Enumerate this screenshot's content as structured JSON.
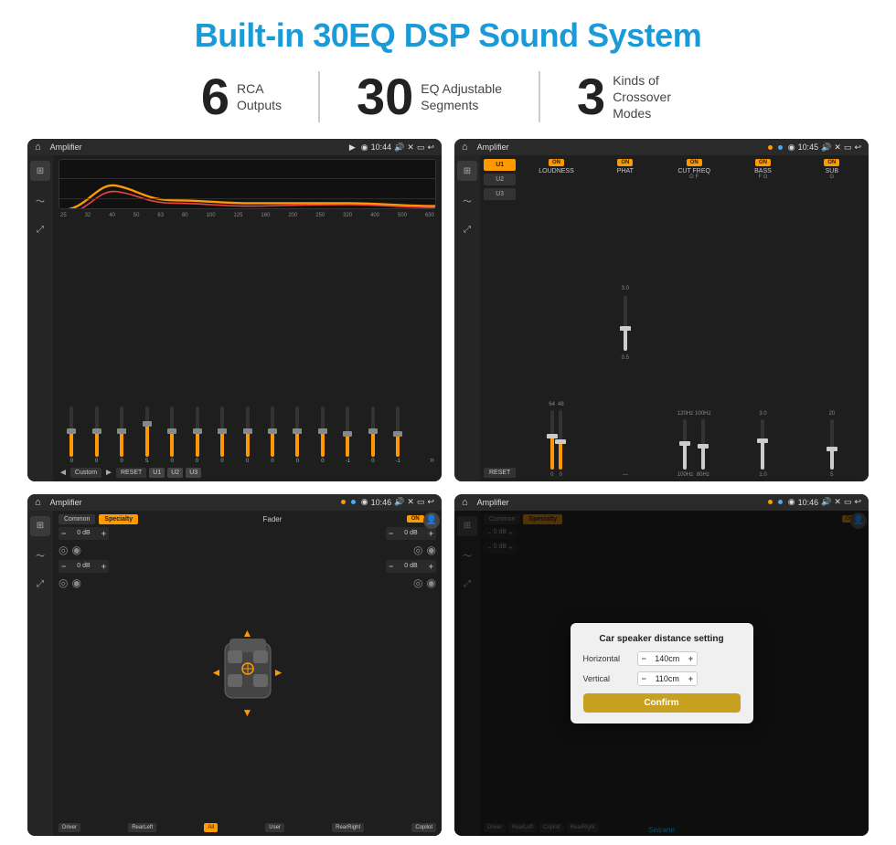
{
  "header": {
    "title": "Built-in 30EQ DSP Sound System",
    "title_color": "#1a9ad7"
  },
  "stats": [
    {
      "number": "6",
      "label": "RCA\nOutputs"
    },
    {
      "number": "30",
      "label": "EQ Adjustable\nSegments"
    },
    {
      "number": "3",
      "label": "Kinds of\nCrossover Modes"
    }
  ],
  "screens": {
    "top_left": {
      "status_bar": {
        "title": "Amplifier",
        "time": "10:44"
      },
      "eq_freqs": [
        "25",
        "32",
        "40",
        "50",
        "63",
        "80",
        "100",
        "125",
        "160",
        "200",
        "250",
        "320",
        "400",
        "500",
        "630"
      ],
      "eq_values": [
        "0",
        "0",
        "0",
        "5",
        "0",
        "0",
        "0",
        "0",
        "0",
        "0",
        "0",
        "-1",
        "0",
        "-1"
      ],
      "bottom_buttons": [
        "Custom",
        "RESET",
        "U1",
        "U2",
        "U3"
      ]
    },
    "top_right": {
      "status_bar": {
        "title": "Amplifier",
        "time": "10:45"
      },
      "presets": [
        "U1",
        "U2",
        "U3"
      ],
      "controls": [
        {
          "on": true,
          "label": "LOUDNESS"
        },
        {
          "on": true,
          "label": "PHAT"
        },
        {
          "on": true,
          "label": "CUT FREQ"
        },
        {
          "on": true,
          "label": "BASS"
        },
        {
          "on": true,
          "label": "SUB"
        }
      ],
      "reset_btn": "RESET"
    },
    "bottom_left": {
      "status_bar": {
        "title": "Amplifier",
        "time": "10:46"
      },
      "tabs": [
        "Common",
        "Specialty"
      ],
      "fader_label": "Fader",
      "on_badge": "ON",
      "db_values": [
        "0 dB",
        "0 dB",
        "0 dB",
        "0 dB"
      ],
      "position_buttons": [
        "Driver",
        "RearLeft",
        "All",
        "User",
        "RearRight",
        "Copilot"
      ]
    },
    "bottom_right": {
      "status_bar": {
        "title": "Amplifier",
        "time": "10:46"
      },
      "tabs": [
        "Common",
        "Specialty"
      ],
      "on_badge": "ON",
      "dialog": {
        "title": "Car speaker distance setting",
        "fields": [
          {
            "label": "Horizontal",
            "value": "140cm"
          },
          {
            "label": "Vertical",
            "value": "110cm"
          }
        ],
        "confirm_label": "Confirm"
      },
      "db_values": [
        "0 dB",
        "0 dB"
      ],
      "position_buttons": [
        "Driver",
        "RearLeft",
        "Copilot",
        "RearRight"
      ]
    }
  },
  "watermark": "Seicane"
}
